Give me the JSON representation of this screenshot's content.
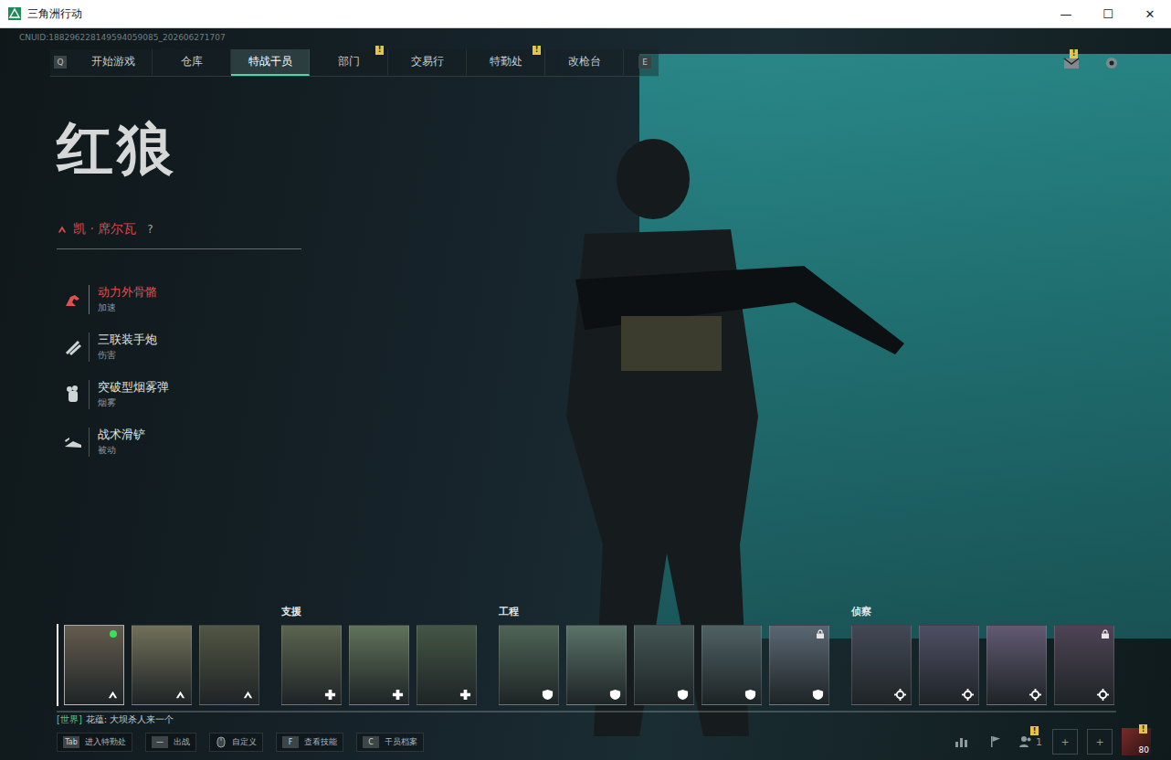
{
  "window": {
    "title": "三角洲行动",
    "controls": [
      "—",
      "☐",
      "✕"
    ]
  },
  "uid": "CNUID:188296228149594059085_202606271707",
  "nav": {
    "prev_key": "Q",
    "next_key": "E",
    "tabs": [
      {
        "label": "开始游戏",
        "selected": false,
        "badge": ""
      },
      {
        "label": "仓库",
        "selected": false,
        "badge": ""
      },
      {
        "label": "特战干员",
        "selected": true,
        "badge": ""
      },
      {
        "label": "部门",
        "selected": false,
        "badge": "!"
      },
      {
        "label": "交易行",
        "selected": false,
        "badge": ""
      },
      {
        "label": "特勤处",
        "selected": false,
        "badge": "!"
      },
      {
        "label": "改枪台",
        "selected": false,
        "badge": ""
      }
    ]
  },
  "header_icons": [
    {
      "kind": "mail",
      "badge": "!"
    },
    {
      "kind": "settings",
      "badge": ""
    }
  ],
  "operator": {
    "name": "红狼",
    "codename": "凯 · 席尔瓦",
    "help": "?",
    "skills": [
      {
        "name": "动力外骨骼",
        "type": "加速",
        "selected": true,
        "kind": "exoskeleton"
      },
      {
        "name": "三联装手炮",
        "type": "伤害",
        "selected": false,
        "kind": "launcher"
      },
      {
        "name": "突破型烟雾弹",
        "type": "烟雾",
        "selected": false,
        "kind": "smoke"
      },
      {
        "name": "战术滑铲",
        "type": "被动",
        "selected": false,
        "kind": "slide"
      }
    ]
  },
  "roster": [
    {
      "label": "",
      "operators": [
        {
          "role": "assault",
          "selected": true,
          "online": true,
          "locked": false
        },
        {
          "role": "assault",
          "selected": false,
          "online": false,
          "locked": false
        },
        {
          "role": "assault",
          "selected": false,
          "online": false,
          "locked": false
        }
      ]
    },
    {
      "label": "支援",
      "operators": [
        {
          "role": "support",
          "selected": false,
          "online": false,
          "locked": false
        },
        {
          "role": "support",
          "selected": false,
          "online": false,
          "locked": false
        },
        {
          "role": "support",
          "selected": false,
          "online": false,
          "locked": false
        }
      ]
    },
    {
      "label": "工程",
      "operators": [
        {
          "role": "engineer",
          "selected": false,
          "online": false,
          "locked": false
        },
        {
          "role": "engineer",
          "selected": false,
          "online": false,
          "locked": false
        },
        {
          "role": "engineer",
          "selected": false,
          "online": false,
          "locked": false
        },
        {
          "role": "engineer",
          "selected": false,
          "online": false,
          "locked": false
        },
        {
          "role": "engineer",
          "selected": false,
          "online": false,
          "locked": true
        }
      ]
    },
    {
      "label": "侦察",
      "operators": [
        {
          "role": "recon",
          "selected": false,
          "online": false,
          "locked": false
        },
        {
          "role": "recon",
          "selected": false,
          "online": false,
          "locked": false
        },
        {
          "role": "recon",
          "selected": false,
          "online": false,
          "locked": false
        },
        {
          "role": "recon",
          "selected": false,
          "online": false,
          "locked": true
        }
      ]
    }
  ],
  "chat": {
    "channel": "[世界]",
    "message": "花蕴: 大坝杀人来一个"
  },
  "hotkeys": [
    {
      "key": "Tab",
      "label": "进入特勤处",
      "kind": "key"
    },
    {
      "key": "—",
      "label": "出战",
      "kind": "key"
    },
    {
      "key": "",
      "label": "自定义",
      "kind": "mouse"
    },
    {
      "key": "F",
      "label": "查看技能",
      "kind": "key"
    },
    {
      "key": "C",
      "label": "干员档案",
      "kind": "key"
    }
  ],
  "social": [
    {
      "kind": "stats",
      "text": "",
      "badge": ""
    },
    {
      "kind": "flag",
      "text": "",
      "badge": ""
    },
    {
      "kind": "friends",
      "text": "1",
      "badge": "!"
    },
    {
      "kind": "slot",
      "text": "+",
      "badge": ""
    },
    {
      "kind": "slot",
      "text": "+",
      "badge": ""
    },
    {
      "kind": "avatar",
      "text": "80",
      "badge": "!"
    }
  ]
}
